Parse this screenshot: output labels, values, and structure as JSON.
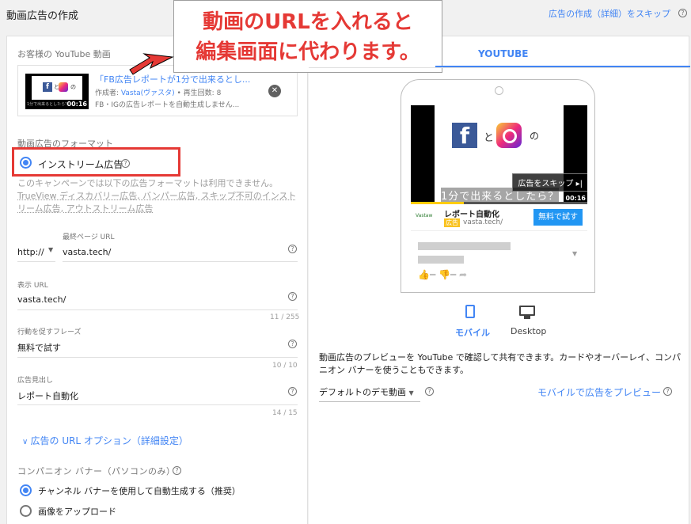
{
  "header": {
    "title": "動画広告の作成",
    "skip_link": "広告の作成（詳細）をスキップ"
  },
  "callout": {
    "line1": "動画のURLを入れると",
    "line2": "編集画面に代わります。"
  },
  "video_picker": {
    "label": "お客様の YouTube 動画",
    "title": "「FB広告レポートが1分で出来るとし...",
    "author_prefix": "作成者: ",
    "author": "Vasta(ヴァスタ)",
    "views": " • 再生回数: 8",
    "description": "FB・IGの広告レポートを自動生成しません...",
    "duration": "00:16",
    "thumb_f": "f",
    "thumb_to": "と",
    "thumb_no": "の",
    "thumb_sub": "1分で出来るとしたら？"
  },
  "format": {
    "label": "動画広告のフォーマット",
    "selected": "インストリーム広告",
    "notice_prefix": "このキャンペーンでは以下の広告フォーマットは利用できません。",
    "notice_items": "TrueView ディスカバリー広告, バンパー広告, スキップ不可のインストリーム広告, アウトストリーム広告"
  },
  "final_url": {
    "label": "最終ページ URL",
    "protocol": "http://",
    "value": "vasta.tech/"
  },
  "display_url": {
    "label": "表示 URL",
    "value": "vasta.tech/",
    "counter": "11 / 255"
  },
  "cta": {
    "label": "行動を促すフレーズ",
    "value": "無料で試す",
    "counter": "10 / 10"
  },
  "headline": {
    "label": "広告見出し",
    "value": "レポート自動化",
    "counter": "14 / 15"
  },
  "url_options": "広告の URL オプション（詳細設定）",
  "companion": {
    "label": "コンパニオン バナー（パソコンのみ）",
    "option1": "チャンネル バナーを使用して自動生成する（推奨）",
    "option2": "画像をアップロード"
  },
  "preview": {
    "tab": "YOUTUBE",
    "video_f": "f",
    "video_to": "と",
    "video_no": "の",
    "subtitle": "1分で出来るとしたら？",
    "skip": "広告をスキップ ▸|",
    "duration": "00:16",
    "progress": 0.3,
    "ad_logo": "Vastaw",
    "ad_name": "レポート自動化",
    "ad_badge": "広告",
    "ad_url": "vasta.tech/",
    "ad_cta": "無料で試す",
    "device_mobile": "モバイル",
    "device_desktop": "Desktop",
    "description": "動画広告のプレビューを YouTube で確認して共有できます。カードやオーバーレイ、コンパニオン バナーを使うこともできます。",
    "demo_select": "デフォルトのデモ動画",
    "mobile_preview_link": "モバイルで広告をプレビュー"
  },
  "colors": {
    "accent": "#4285f4",
    "highlight": "#e53935",
    "cta": "#2196f3"
  }
}
